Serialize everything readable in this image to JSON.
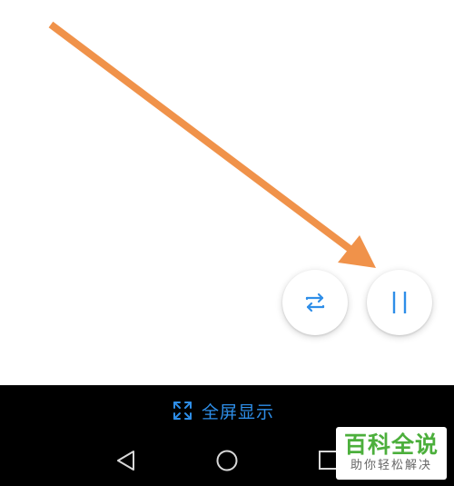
{
  "annotation": {
    "arrow_color": "#f0924a"
  },
  "controls": {
    "switch_icon": "swap-arrows-icon",
    "pause_icon": "pause-icon",
    "accent_color": "#2e8ee8"
  },
  "bottom_bar": {
    "fullscreen_icon": "expand-icon",
    "fullscreen_label": "全屏显示"
  },
  "navigation": {
    "back_icon": "back-triangle-icon",
    "home_icon": "home-circle-icon",
    "recent_icon": "recent-square-icon"
  },
  "watermark": {
    "title": "百科全说",
    "subtitle": "助你轻松解决"
  }
}
